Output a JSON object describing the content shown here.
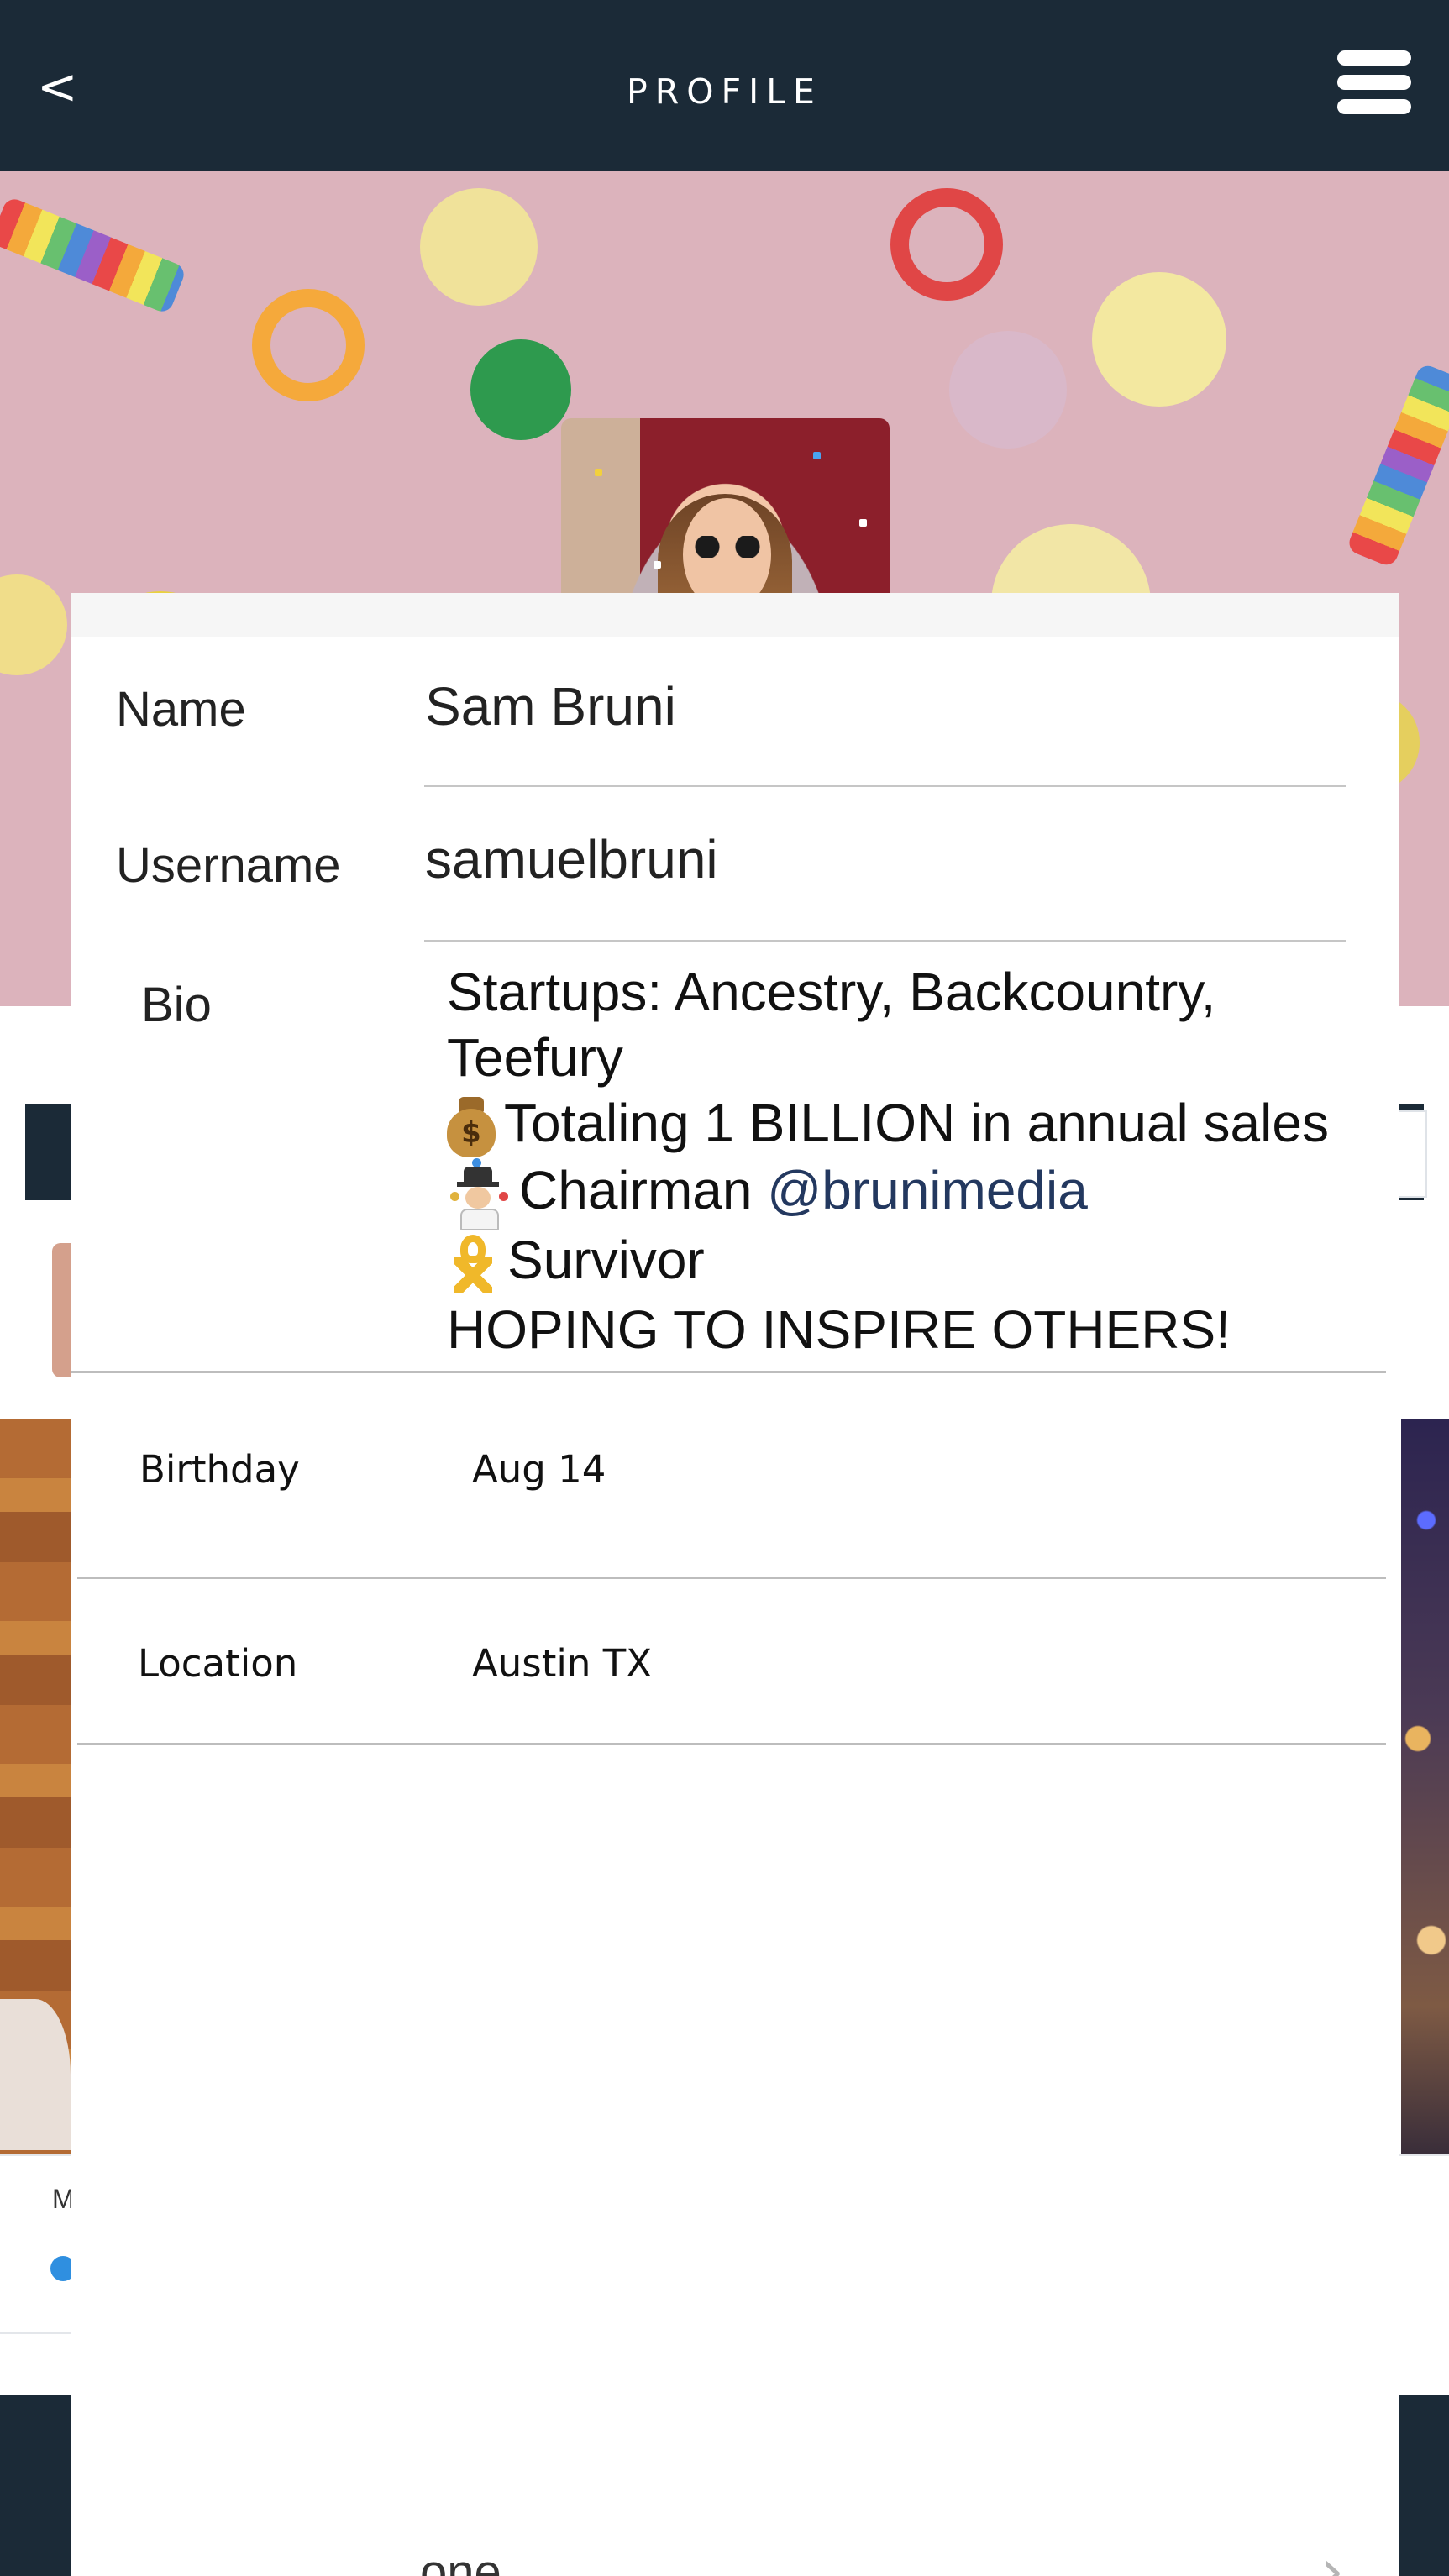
{
  "nav": {
    "back_glyph": "<",
    "title": "PROFILE",
    "menu_icon": "hamburger-menu-icon"
  },
  "profile": {
    "name_label": "Name",
    "name_value": "Sam Bruni",
    "username_label": "Username",
    "username_value": "samuelbruni",
    "bio_label": "Bio",
    "bio": {
      "line1": "Startups: Ancestry, Backcountry,",
      "line2": "Teefury",
      "line3": "Totaling 1 BILLION in annual sales",
      "line4_prefix": "Chairman",
      "line4_mention": "@brunimedia",
      "line5": "Survivor",
      "line6": "HOPING TO INSPIRE OTHERS!",
      "emoji_line3": "money-bag-emoji",
      "emoji_line4": "man-juggling-emoji",
      "emoji_line5": "yellow-ribbon-emoji"
    },
    "birthday_label": "Birthday",
    "birthday_value": "Aug 14",
    "location_label": "Location",
    "location_value": "Austin TX",
    "cutoff_text": "one"
  },
  "colors": {
    "nav_background": "#1b2a37",
    "mention": "#23385f",
    "cover_background": "#dcb3bc"
  },
  "background_page": {
    "card_text_partial": "M"
  }
}
